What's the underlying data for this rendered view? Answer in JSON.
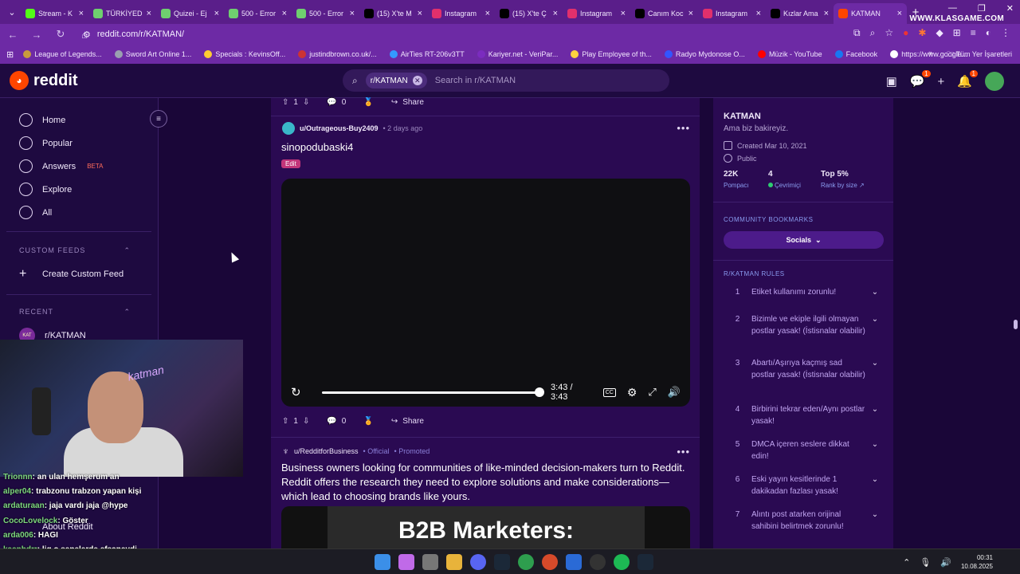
{
  "browser": {
    "tabs": [
      {
        "label": "Stream - K",
        "color": "#53fc18"
      },
      {
        "label": "TÜRKİYED",
        "color": "#6fcf6f"
      },
      {
        "label": "Quizei - Ej",
        "color": "#6fcf6f"
      },
      {
        "label": "500 - Error",
        "color": "#6fcf6f"
      },
      {
        "label": "500 - Error",
        "color": "#6fcf6f"
      },
      {
        "label": "(15) X'te M",
        "color": "#000000"
      },
      {
        "label": "Instagram",
        "color": "#e1306c"
      },
      {
        "label": "(15) X'te Ç",
        "color": "#000000"
      },
      {
        "label": "Instagram",
        "color": "#e1306c"
      },
      {
        "label": "Canım Koc",
        "color": "#000000"
      },
      {
        "label": "Instagram",
        "color": "#e1306c"
      },
      {
        "label": "Kızlar Ama",
        "color": "#000000"
      },
      {
        "label": "KATMAN",
        "color": "#ff4500",
        "active": true
      }
    ],
    "url": "reddit.com/r/KATMAN/",
    "watermark": "WWW.KLASGAME.COM",
    "bookmarks": [
      {
        "label": "League of Legends...",
        "color": "#c89b3c"
      },
      {
        "label": "Sword Art Online 1...",
        "color": "#9aa0b0"
      },
      {
        "label": "Specials : KevinsOff...",
        "color": "#ffcc33"
      },
      {
        "label": "justindbrown.co.uk/...",
        "color": "#cc3333"
      },
      {
        "label": "AirTies RT-206v3TT",
        "color": "#3399ff"
      },
      {
        "label": "Kariyer.net - VeriPar...",
        "color": "#7b2cbf"
      },
      {
        "label": "Play Employee of th...",
        "color": "#ffd23f"
      },
      {
        "label": "Radyo Mydonose O...",
        "color": "#3355ff"
      },
      {
        "label": "Müzik - YouTube",
        "color": "#ff0000"
      },
      {
        "label": "Facebook",
        "color": "#1877f2"
      },
      {
        "label": "https://www.google...",
        "color": "#ffffff"
      }
    ],
    "all_bookmarks": "Tüm Yer İşaretleri"
  },
  "header": {
    "logo": "reddit",
    "search_chip": "r/KATMAN",
    "search_placeholder": "Search in r/KATMAN",
    "chat_badge": "1",
    "notif_badge": "1"
  },
  "leftnav": {
    "items": [
      "Home",
      "Popular",
      "Answers",
      "Explore",
      "All"
    ],
    "beta": "BETA",
    "custom_feeds": "CUSTOM FEEDS",
    "create_feed": "Create Custom Feed",
    "recent": "RECENT",
    "recent_item": "r/KATMAN",
    "about": "About Reddit"
  },
  "chat": [
    {
      "user": "Trionnn",
      "msg": ": an ulan hemşerum an"
    },
    {
      "user": "alper04",
      "msg": ": trabzonu trabzon yapan kişi"
    },
    {
      "user": "ardaturaan",
      "msg": ": jaja vardı jaja @hype"
    },
    {
      "user": "CocoLovelock",
      "msg": ": Göster"
    },
    {
      "user": "arda006",
      "msg": ": HAGI"
    },
    {
      "user": "kaanbdrr",
      "msg": ": lig o senelerde efsaneydi"
    }
  ],
  "webcam_neon": "katman",
  "main": {
    "top_actions": {
      "votes": "1",
      "comments": "0",
      "share": "Share"
    },
    "post": {
      "user": "u/Outrageous-Buy2409",
      "time": "• 2 days ago",
      "title": "sinopodubaski4",
      "flair": "Edit",
      "video_time": "3:43 / 3:43",
      "progress": 1.0,
      "votes": "1",
      "comments": "0",
      "share": "Share"
    },
    "promo": {
      "user": "u/RedditforBusiness",
      "official": "• Official",
      "promoted": "• Promoted",
      "title": "Business owners looking for communities of like-minded decision-makers turn to Reddit. Reddit offers the research they need to explore solutions and make considerations—which lead to choosing brands like yours.",
      "image_text": "B2B Marketers:"
    }
  },
  "sidebar": {
    "name": "KATMAN",
    "desc": "Ama biz bakireyiz.",
    "created": "Created Mar 10, 2021",
    "public": "Public",
    "members": "22K",
    "members_label": "Pompacı",
    "online": "4",
    "online_label": "Çevrimiçi",
    "rank": "Top 5%",
    "rank_label": "Rank by size",
    "bookmarks_title": "COMMUNITY BOOKMARKS",
    "socials": "Socials",
    "rules_title": "R/KATMAN RULES",
    "rules": [
      {
        "n": "1",
        "text": "Etiket kullanımı zorunlu!"
      },
      {
        "n": "2",
        "text": "Bizimle ve ekiple ilgili olmayan postlar yasak! (İstisnalar olabilir)"
      },
      {
        "n": "3",
        "text": "Abartı/Aşırıya kaçmış sad postlar yasak! (İstisnalar olabilir)"
      },
      {
        "n": "4",
        "text": "Birbirini tekrar eden/Aynı postlar yasak!"
      },
      {
        "n": "5",
        "text": "DMCA içeren seslere dikkat edin!"
      },
      {
        "n": "6",
        "text": "Eski yayın kesitlerinde 1 dakikadan fazlası yasak!"
      },
      {
        "n": "7",
        "text": "Alıntı post atarken orijinal sahibini belirtmek zorunlu!"
      }
    ]
  },
  "taskbar": {
    "time": "00:31",
    "date": "10.08.2025"
  }
}
